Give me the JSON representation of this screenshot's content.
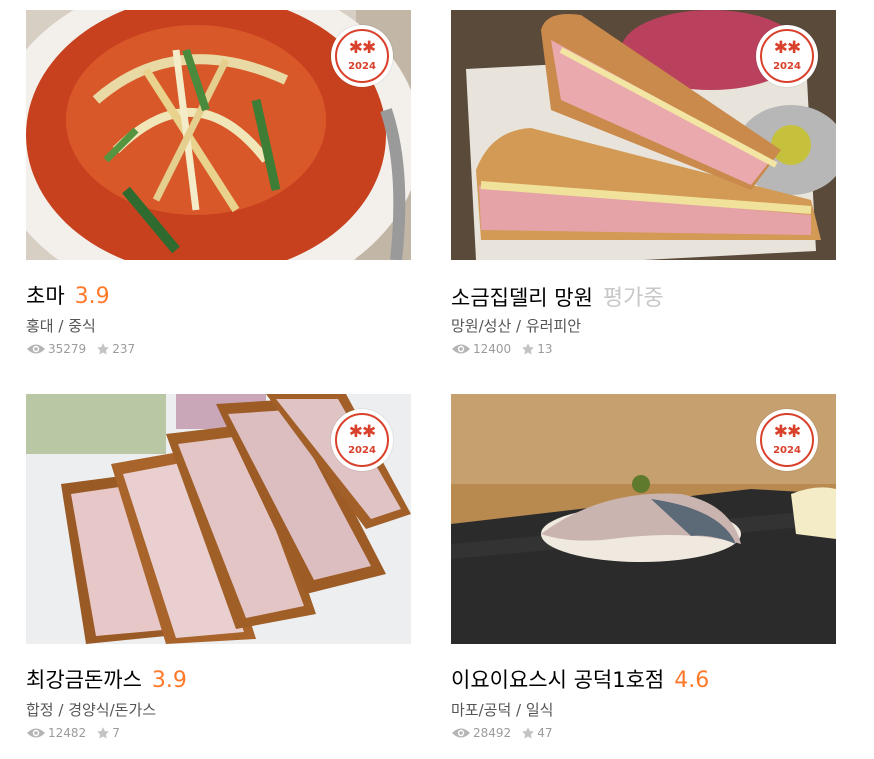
{
  "badge": {
    "year": "2024",
    "stars": "✱✱"
  },
  "restaurants": [
    {
      "name": "초마",
      "score": "3.9",
      "area": "홍대",
      "category": "중식",
      "views": "35279",
      "reviews": "237"
    },
    {
      "name": "소금집델리 망원",
      "score": "평가중",
      "area": "망원/성산",
      "category": "유러피안",
      "views": "12400",
      "reviews": "13"
    },
    {
      "name": "최강금돈까스",
      "score": "3.9",
      "area": "합정",
      "category": "경양식/돈가스",
      "views": "12482",
      "reviews": "7"
    },
    {
      "name": "이요이요스시 공덕1호점",
      "score": "4.6",
      "area": "마포/공덕",
      "category": "일식",
      "views": "28492",
      "reviews": "47"
    }
  ],
  "icons": {
    "views": "eye-icon",
    "reviews": "star-icon",
    "badge": "ribbon-award-icon"
  },
  "colors": {
    "score": "#ff792a",
    "pending": "#c8c8c8",
    "badge": "#d9412c"
  }
}
